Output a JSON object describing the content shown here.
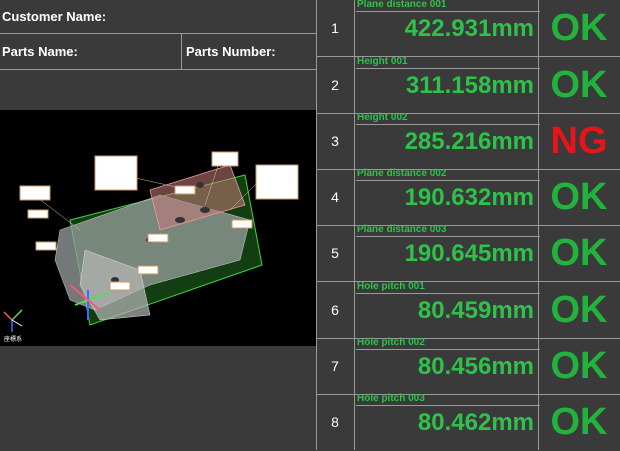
{
  "header": {
    "customer_label": "Customer Name:",
    "parts_name_label": "Parts Name:",
    "parts_number_label": "Parts Number:"
  },
  "viewer": {
    "footer_label": "座標系"
  },
  "measurements": [
    {
      "num": "1",
      "name": "Plane distance 001",
      "value": "422.931mm",
      "result": "OK"
    },
    {
      "num": "2",
      "name": "Height 001",
      "value": "311.158mm",
      "result": "OK"
    },
    {
      "num": "3",
      "name": "Height 002",
      "value": "285.216mm",
      "result": "NG"
    },
    {
      "num": "4",
      "name": "Plane distance 002",
      "value": "190.632mm",
      "result": "OK"
    },
    {
      "num": "5",
      "name": "Plane distance 003",
      "value": "190.645mm",
      "result": "OK"
    },
    {
      "num": "6",
      "name": "Hole pitch 001",
      "value": "80.459mm",
      "result": "OK"
    },
    {
      "num": "7",
      "name": "Hole pitch 002",
      "value": "80.456mm",
      "result": "OK"
    },
    {
      "num": "8",
      "name": "Hole pitch 003",
      "value": "80.462mm",
      "result": "OK"
    }
  ],
  "colors": {
    "ok": "#22b33c",
    "ng": "#e5151c",
    "value": "#2ec24a"
  }
}
